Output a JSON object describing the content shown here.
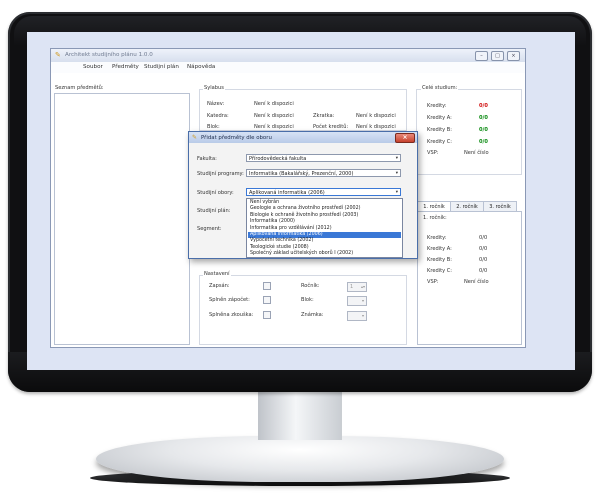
{
  "window": {
    "title": "Architekt studijního plánu 1.0.0",
    "controls": [
      "–",
      "□",
      "×"
    ]
  },
  "menu": [
    "Soubor",
    "Předměty",
    "Studijní plán",
    "Nápověda"
  ],
  "subjects_list": {
    "label": "Seznam předmětů:"
  },
  "sylabus": {
    "title": "Sylabus",
    "nazev_label": "Název:",
    "nazev_value": "Není k dispozici",
    "katedra_label": "Katedra:",
    "katedra_value": "Není k dispozici",
    "zkratka_label": "Zkratka:",
    "zkratka_value": "Není k dispozici",
    "blok_label": "Blok:",
    "blok_value": "Není k dispozici",
    "pocet_label": "Počet kreditů:",
    "pocet_value": "Není k dispozici"
  },
  "cele_studium": {
    "title": "Celé studium:",
    "rows": [
      {
        "label": "Kredity:",
        "value": "0/0"
      },
      {
        "label": "Kredity A:",
        "value": "0/0"
      },
      {
        "label": "Kredity B:",
        "value": "0/0"
      },
      {
        "label": "Kredity C:",
        "value": "0/0"
      }
    ],
    "vsp_label": "VSP:",
    "vsp_value": "Není číslo"
  },
  "tabs": [
    "1. ročník",
    "2. ročník",
    "3. ročník"
  ],
  "rocnik": {
    "title": "1. ročník:",
    "rows": [
      {
        "label": "Kredity:",
        "value": "0/0"
      },
      {
        "label": "Kredity A:",
        "value": "0/0"
      },
      {
        "label": "Kredity B:",
        "value": "0/0"
      },
      {
        "label": "Kredity C:",
        "value": "0/0"
      }
    ],
    "vsp_label": "VSP:",
    "vsp_value": "Není číslo"
  },
  "nastaveni": {
    "title": "Nastavení",
    "zapsan_label": "Zapsán:",
    "zapocet_label": "Splněn zápočet:",
    "zkouska_label": "Splněna zkouška:",
    "rocnik_label": "Ročník:",
    "rocnik_value": "1",
    "blok_label": "Blok:",
    "znamka_label": "Známka:"
  },
  "dialog": {
    "title": "Přidat předměty dle oboru",
    "close": "×",
    "fakulta_label": "Fakulta:",
    "fakulta_value": "Přírodovědecká fakulta",
    "programy_label": "Studijní programy:",
    "programy_value": "Informatika (Bakalářský, Prezenční, 2000)",
    "obory_label": "Studijní obory:",
    "obory_value": "Aplikovaná informatika (2006)",
    "plan_label": "Studijní plán:",
    "segment_label": "Segment:",
    "options": [
      "Není vybrán",
      "Geologie a ochrana životního prostředí (2002)",
      "Biologie k ochraně životního prostředí (2003)",
      "Informatika (2000)",
      "Informatika pro vzdělávání (2012)",
      "Aplikovaná informatika (2006)",
      "Výpočetní technika (2002)",
      "Teologické studie (2008)",
      "Společný základ učitelských oborů I (2002)"
    ],
    "selected_index": 5
  },
  "colors": {
    "accent": "#3a78d6",
    "bad": "#d01010",
    "good": "#0b8b12"
  }
}
